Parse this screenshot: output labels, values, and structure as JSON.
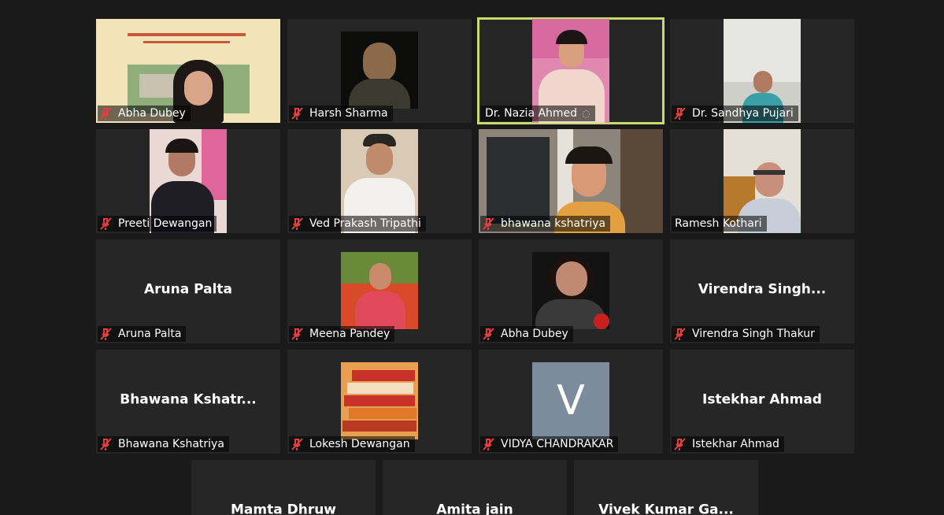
{
  "colors": {
    "background": "#1a1a1a",
    "tile": "#262626",
    "active_speaker_border": "#c8dc6e",
    "muted_icon": "#e53e3e",
    "avatar_bg": "#7d8c9c"
  },
  "icons": {
    "muted": "microphone-muted-icon"
  },
  "participants": [
    {
      "name": "Abha Dubey",
      "has_video": true
    },
    {
      "name": "Harsh Sharma",
      "has_video": true
    },
    {
      "name": "Dr. Nazia Ahmed",
      "has_video": true,
      "active_speaker": true
    },
    {
      "name": "Dr. Sandhya Pujari",
      "has_video": true
    },
    {
      "name": "Preeti Dewangan",
      "has_video": true
    },
    {
      "name": "Ved Prakash Tripathi",
      "has_video": true
    },
    {
      "name": "bhawana kshatriya",
      "has_video": true
    },
    {
      "name": "Ramesh Kothari",
      "has_video": true
    },
    {
      "name": "Aruna Palta",
      "display_name": "Aruna Palta",
      "has_video": false
    },
    {
      "name": "Meena Pandey",
      "has_video": true
    },
    {
      "name": "Abha Dubey",
      "has_video": true
    },
    {
      "name": "Virendra Singh Thakur",
      "display_name": "Virendra  Singh...",
      "has_video": false
    },
    {
      "name": "Bhawana Kshatriya",
      "display_name": "Bhawana  Kshatr...",
      "has_video": false
    },
    {
      "name": "Lokesh Dewangan",
      "has_video": true
    },
    {
      "name": "VIDYA CHANDRAKAR",
      "avatar_letter": "V",
      "has_video": false
    },
    {
      "name": "Istekhar Ahmad",
      "display_name": "Istekhar Ahmad",
      "has_video": false
    },
    {
      "display_name": "Mamta Dhruw",
      "has_video": false
    },
    {
      "display_name": "Amita jain",
      "has_video": false
    },
    {
      "display_name": "Vivek  Kumar  Ga...",
      "has_video": false
    }
  ]
}
